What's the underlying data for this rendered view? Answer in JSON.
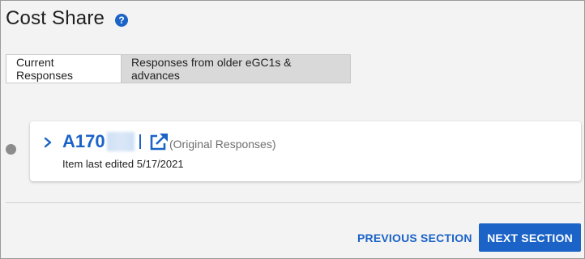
{
  "page": {
    "title": "Cost Share"
  },
  "tabs": [
    {
      "label": "Current Responses",
      "active": true
    },
    {
      "label": "Responses from older eGC1s & advances",
      "active": false
    }
  ],
  "item": {
    "id_prefix": "A170",
    "original_link_label": "(Original Responses)",
    "last_edited": "Item last edited 5/17/2021"
  },
  "footer": {
    "previous_label": "PREVIOUS SECTION",
    "next_label": "NEXT SECTION"
  },
  "icons": {
    "help": "help-circle-icon",
    "expand": "chevron-right-icon",
    "external": "external-link-icon"
  },
  "colors": {
    "accent": "#1b63c7",
    "status_dot": "#8c8c8c",
    "tab_inactive_bg": "#d9d9d9"
  }
}
